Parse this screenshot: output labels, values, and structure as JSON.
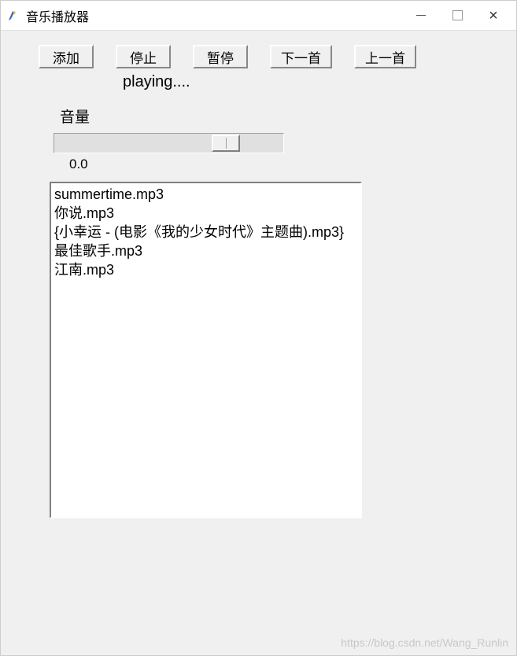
{
  "window": {
    "title": "音乐播放器"
  },
  "toolbar": {
    "add_label": "添加",
    "stop_label": "停止",
    "pause_label": "暂停",
    "next_label": "下一首",
    "prev_label": "上一首"
  },
  "status": {
    "text": "playing...."
  },
  "volume": {
    "label": "音量",
    "value_text": "0.0"
  },
  "playlist": {
    "items": [
      "summertime.mp3",
      "你说.mp3",
      "{小幸运 - (电影《我的少女时代》主题曲).mp3}",
      "最佳歌手.mp3",
      "江南.mp3"
    ]
  },
  "watermark": "https://blog.csdn.net/Wang_Runlin"
}
